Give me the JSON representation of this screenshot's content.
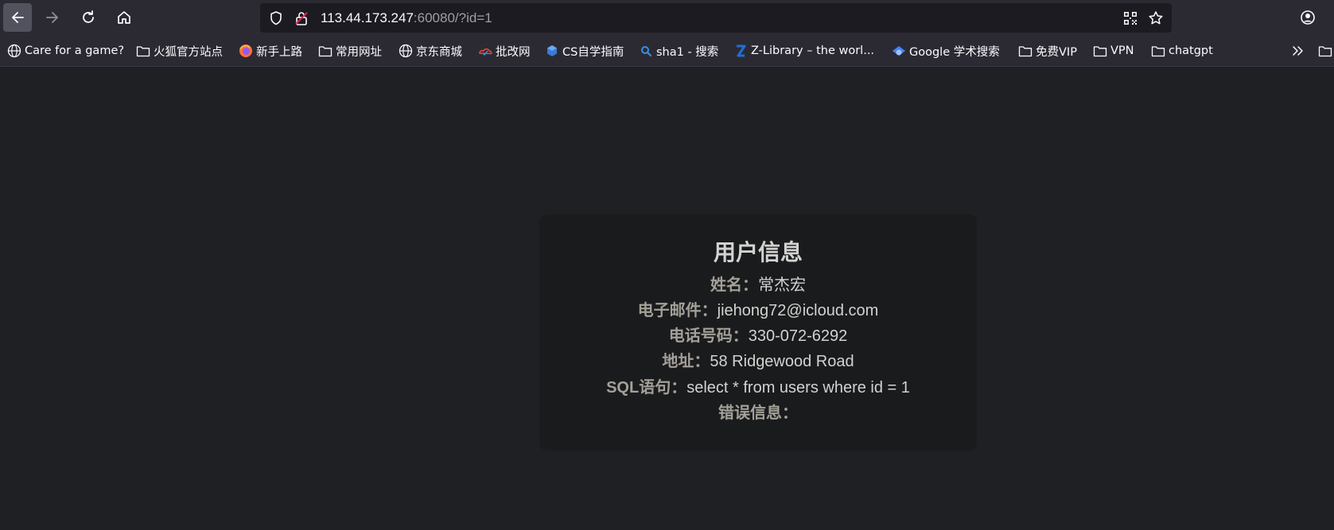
{
  "browser": {
    "url_host": "113.44.173.247",
    "url_rest": ":60080/?id=1",
    "bookmarks": [
      {
        "label": "Care for a game?",
        "icon": "globe-icon"
      },
      {
        "label": "火狐官方站点",
        "icon": "folder-icon"
      },
      {
        "label": "新手上路",
        "icon": "firefox-icon"
      },
      {
        "label": "常用网址",
        "icon": "folder-icon"
      },
      {
        "label": "京东商城",
        "icon": "globe-icon"
      },
      {
        "label": "批改网",
        "icon": "pigai-icon"
      },
      {
        "label": "CS自学指南",
        "icon": "cube-icon"
      },
      {
        "label": "sha1 - 搜索",
        "icon": "search-icon"
      },
      {
        "label": "Z-Library – the worl...",
        "icon": "zlibrary-icon"
      },
      {
        "label": "Google 学术搜索",
        "icon": "scholar-icon"
      },
      {
        "label": "免费VIP",
        "icon": "folder-icon"
      },
      {
        "label": "VPN",
        "icon": "folder-icon"
      },
      {
        "label": "chatgpt",
        "icon": "folder-icon"
      }
    ]
  },
  "card": {
    "title": "用户信息",
    "rows": [
      {
        "label": "姓名：",
        "value": "常杰宏"
      },
      {
        "label": "电子邮件：",
        "value": "jiehong72@icloud.com"
      },
      {
        "label": "电话号码：",
        "value": "330-072-6292"
      },
      {
        "label": "地址：",
        "value": "58 Ridgewood Road"
      },
      {
        "label": "SQL语句：",
        "value": "select * from users where id = 1"
      },
      {
        "label": "错误信息：",
        "value": ""
      }
    ]
  },
  "colors": {
    "toolbar_bg": "#2b2a33",
    "page_bg": "#1f2023",
    "card_bg": "#1a1b1d",
    "label_color": "#a3a098",
    "value_color": "#d2d2d0"
  }
}
